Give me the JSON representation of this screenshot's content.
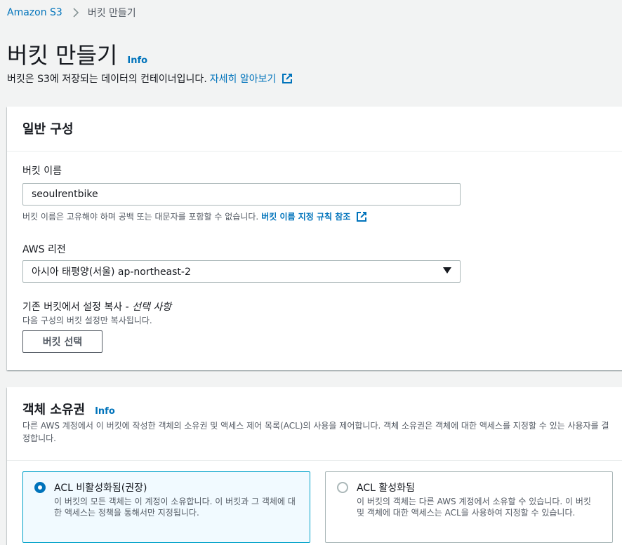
{
  "breadcrumb": {
    "root": "Amazon S3",
    "current": "버킷 만들기"
  },
  "page": {
    "title": "버킷 만들기",
    "info": "Info",
    "subtitle": "버킷은 S3에 저장되는 데이터의 컨테이너입니다.",
    "learn_more": "자세히 알아보기"
  },
  "general": {
    "header": "일반 구성",
    "bucket_name_label": "버킷 이름",
    "bucket_name_value": "seoulrentbike",
    "bucket_name_hint": "버킷 이름은 고유해야 하며 공백 또는 대문자를 포함할 수 없습니다.",
    "bucket_name_rules_link": "버킷 이름 지정 규칙 참조",
    "region_label": "AWS 리전",
    "region_value": "아시아 태평양(서울) ap-northeast-2",
    "copy_label": "기존 버킷에서 설정 복사 - ",
    "copy_optional": "선택 사항",
    "copy_hint": "다음 구성의 버킷 설정만 복사됩니다.",
    "choose_bucket_button": "버킷 선택"
  },
  "ownership": {
    "header": "객체 소유권",
    "info": "Info",
    "description": "다른 AWS 계정에서 이 버킷에 작성한 객체의 소유권 및 액세스 제어 목록(ACL)의 사용을 제어합니다. 객체 소유권은 객체에 대한 액세스를 지정할 수 있는 사용자를 결정합니다.",
    "options": [
      {
        "title": "ACL 비활성화됨(권장)",
        "description": "이 버킷의 모든 객체는 이 계정이 소유합니다. 이 버킷과 그 객체에 대한 액세스는 정책을 통해서만 지정됩니다.",
        "selected": true
      },
      {
        "title": "ACL 활성화됨",
        "description": "이 버킷의 객체는 다른 AWS 계정에서 소유할 수 있습니다. 이 버킷 및 객체에 대한 액세스는 ACL을 사용하여 지정할 수 있습니다.",
        "selected": false
      }
    ]
  },
  "colors": {
    "link": "#0073bb",
    "selected_border": "#00a1c9",
    "selected_bg": "#f1faff"
  }
}
